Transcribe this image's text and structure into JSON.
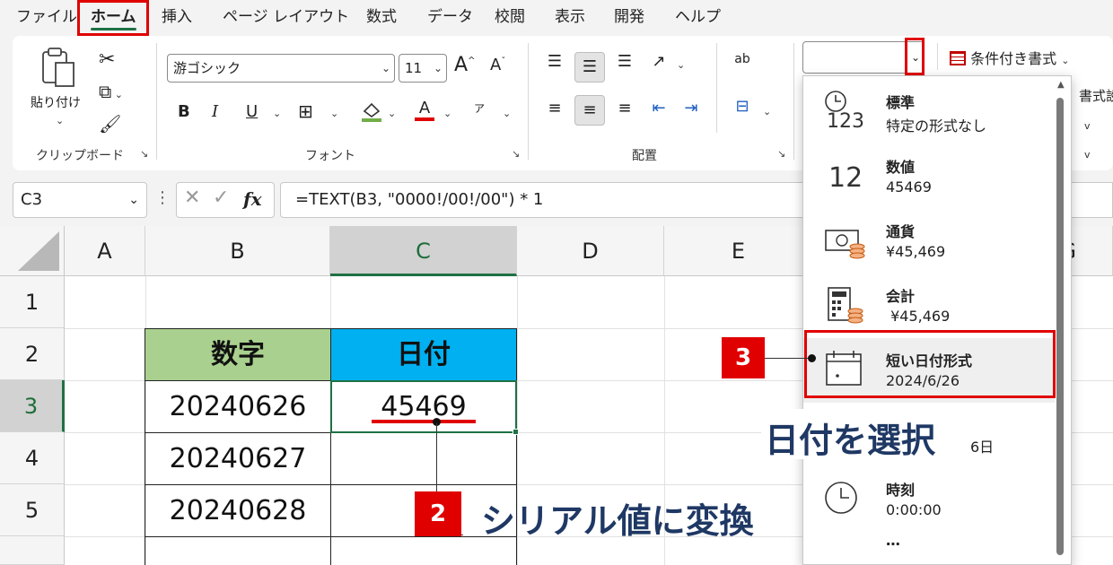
{
  "menu": {
    "items": [
      "ファイル",
      "ホーム",
      "挿入",
      "ページ レイアウト",
      "数式",
      "データ",
      "校閲",
      "表示",
      "開発",
      "ヘルプ"
    ],
    "active_index": 1
  },
  "ribbon": {
    "clipboard": {
      "paste_label": "貼り付け",
      "group_label": "クリップボード"
    },
    "font": {
      "font_name": "游ゴシック",
      "font_size": "11",
      "bold": "B",
      "italic": "I",
      "underline": "U",
      "font_color_letter": "A",
      "grow": "A",
      "shrink": "A",
      "phonetic": "ア",
      "group_label": "フォント"
    },
    "alignment": {
      "group_label": "配置",
      "wrap_label": "ab"
    },
    "number": {
      "format_value": "",
      "conditional_label": "条件付き書式",
      "partial_right_1": "書式設",
      "partial_right_2": "v",
      "partial_right_3": "v"
    }
  },
  "formula_bar": {
    "name_box": "C3",
    "fx": "fx",
    "formula": "=TEXT(B3, \"0000!/00!/00\") * 1"
  },
  "sheet": {
    "columns": [
      "A",
      "B",
      "C",
      "D",
      "E",
      "G"
    ],
    "rows": [
      "1",
      "2",
      "3",
      "4",
      "5"
    ],
    "header_b": "数字",
    "header_c": "日付",
    "b3": "20240626",
    "b4": "20240627",
    "b5": "20240628",
    "c3": "45469",
    "selected_cell": "C3"
  },
  "dropdown": {
    "items": [
      {
        "name": "標準",
        "example": "特定の形式なし",
        "icon": "clock-123-icon"
      },
      {
        "name": "数値",
        "example": "45469",
        "icon": "number-12-icon"
      },
      {
        "name": "通貨",
        "example": "¥45,469",
        "icon": "currency-icon"
      },
      {
        "name": "会計",
        "example": " ¥45,469",
        "icon": "calculator-icon"
      },
      {
        "name": "短い日付形式",
        "example": "2024/6/26",
        "icon": "calendar-icon"
      },
      {
        "name": "時刻",
        "example": "0:00:00",
        "icon": "clock-icon"
      }
    ],
    "highlighted_index": 4,
    "partial_long_date": "6日",
    "icon_123": "123",
    "icon_12": "12"
  },
  "annotations": {
    "badge2": "2",
    "badge3": "3",
    "callout2": "シリアル値に変換",
    "callout3": "日付を選択",
    "accent_red": "#e00000",
    "header_b_color": "#a9d08e",
    "header_c_color": "#00b0f0"
  }
}
